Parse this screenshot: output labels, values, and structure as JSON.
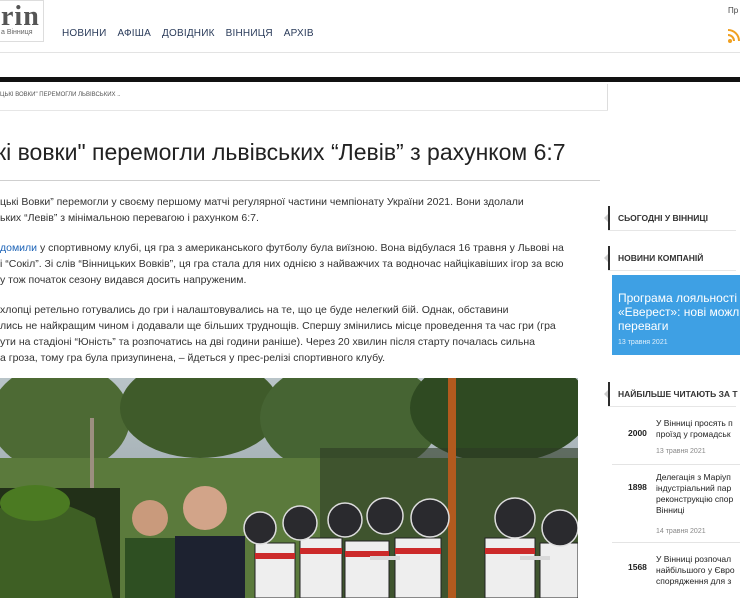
{
  "site": {
    "logo_text": "rin",
    "logo_sub": "а Вінниця",
    "top_right_link": "Пр"
  },
  "nav": [
    "НОВИНИ",
    "АФІША",
    "ДОВІДНИК",
    "ВІННИЦЯ",
    "АРХІВ"
  ],
  "breadcrumb": "ЦЬКІ ВОВКИ\" ПЕРЕМОГЛИ ЛЬВІВСЬКИХ ..",
  "article": {
    "title": "кі вовки\" перемогли львівських “Левів” з рахунком 6:7",
    "p1_l1": "цькі Вовки” перемогли у своєму першому матчі регулярної частини чемпіонату України 2021. Вони здолали",
    "p1_l2": "ьких “Левів” з мінімальною перевагою і рахунком 6:7.",
    "p2_link": "домили",
    "p2_l1_rest": " у спортивному клубі, ця гра з американського футболу була виїзною. Вона відбулася 16 травня у Львові на",
    "p2_l2": "і “Сокіл”. Зі слів “Вінницьких Вовків”, ця гра стала для них однією з найважчих та водночас найцікавіших ігор за всю",
    "p2_l3": "у тож початок сезону видався досить напруженим.",
    "p3_l1": "хлопці ретельно готувались до гри і налаштовувались на те, що це буде нелегкий бій. Однак, обставини",
    "p3_l2": "лись не найкращим чином і додавали ще більших труднощів. Спершу змінились місце проведення та час гри (гра",
    "p3_l3": "ути на стадіоні “Юність” та розпочатись на дві години раніше). Через 20 хвилин після старту почалась сильна",
    "p3_l4": "а гроза, тому гра була призупинена, – йдеться у прес-релізі спортивного клубу."
  },
  "sidebar": {
    "today_label": "СЬОГОДНІ У ВІННИЦІ",
    "companies_label": "НОВИНИ КОМПАНІЙ",
    "company_title_l1": "Програма лояльності",
    "company_title_l2": "«Еверест»: нові можли",
    "company_title_l3": "переваги",
    "company_date": "13 травня 2021",
    "most_read_label": "НАЙБІЛЬШЕ ЧИТАЮТЬ ЗА Т",
    "most_read": [
      {
        "count": "2000",
        "lines": [
          "У Вінниці просять п",
          "проїзд у громадськ"
        ],
        "date": "13 травня 2021"
      },
      {
        "count": "1898",
        "lines": [
          "Делегація з Маріуп",
          "індустріальний пар",
          "реконструкцію спор",
          "Вінниці"
        ],
        "date": "14 травня 2021"
      },
      {
        "count": "1568",
        "lines": [
          "У Вінниці розпочал",
          "найбільшого у Євро",
          "спорядження для з"
        ],
        "date": ""
      }
    ]
  },
  "colors": {
    "link": "#1c63b7",
    "company_card": "#3ea0e4",
    "black_bar": "#111111"
  }
}
